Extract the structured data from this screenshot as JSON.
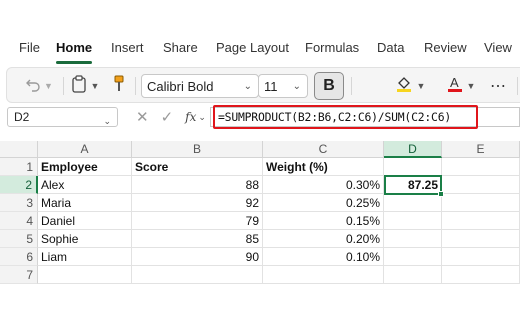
{
  "menu": {
    "items": [
      "File",
      "Home",
      "Insert",
      "Share",
      "Page Layout",
      "Formulas",
      "Data",
      "Review",
      "View"
    ],
    "active": "Home"
  },
  "ribbon": {
    "font_name": "Calibri Bold",
    "font_size": "11",
    "bold_label": "B",
    "icons": [
      "undo-icon",
      "paste-icon",
      "format-painter-icon",
      "fill-color-icon",
      "font-color-icon",
      "more-icon"
    ],
    "fill_color": "#f7d51f",
    "font_color": "#e0151b"
  },
  "formula_bar": {
    "name_box": "D2",
    "fx_label": "fx",
    "formula": "=SUMPRODUCT(B2:B6,C2:C6)/SUM(C2:C6)",
    "highlight_color": "#e0151b"
  },
  "sheet": {
    "columns": [
      "A",
      "B",
      "C",
      "D",
      "E"
    ],
    "selected_column": "D",
    "row_numbers": [
      "1",
      "2",
      "3",
      "4",
      "5",
      "6",
      "7"
    ],
    "selected_row": "2",
    "rows": [
      [
        "Employee",
        "Score",
        "Weight (%)",
        "",
        ""
      ],
      [
        "Alex",
        "88",
        "0.30%",
        "87.25",
        ""
      ],
      [
        "Maria",
        "92",
        "0.25%",
        "",
        ""
      ],
      [
        "Daniel",
        "79",
        "0.15%",
        "",
        ""
      ],
      [
        "Sophie",
        "85",
        "0.20%",
        "",
        ""
      ],
      [
        "Liam",
        "90",
        "0.10%",
        "",
        ""
      ],
      [
        "",
        "",
        "",
        "",
        ""
      ]
    ],
    "accent_color": "#1a7f47"
  }
}
